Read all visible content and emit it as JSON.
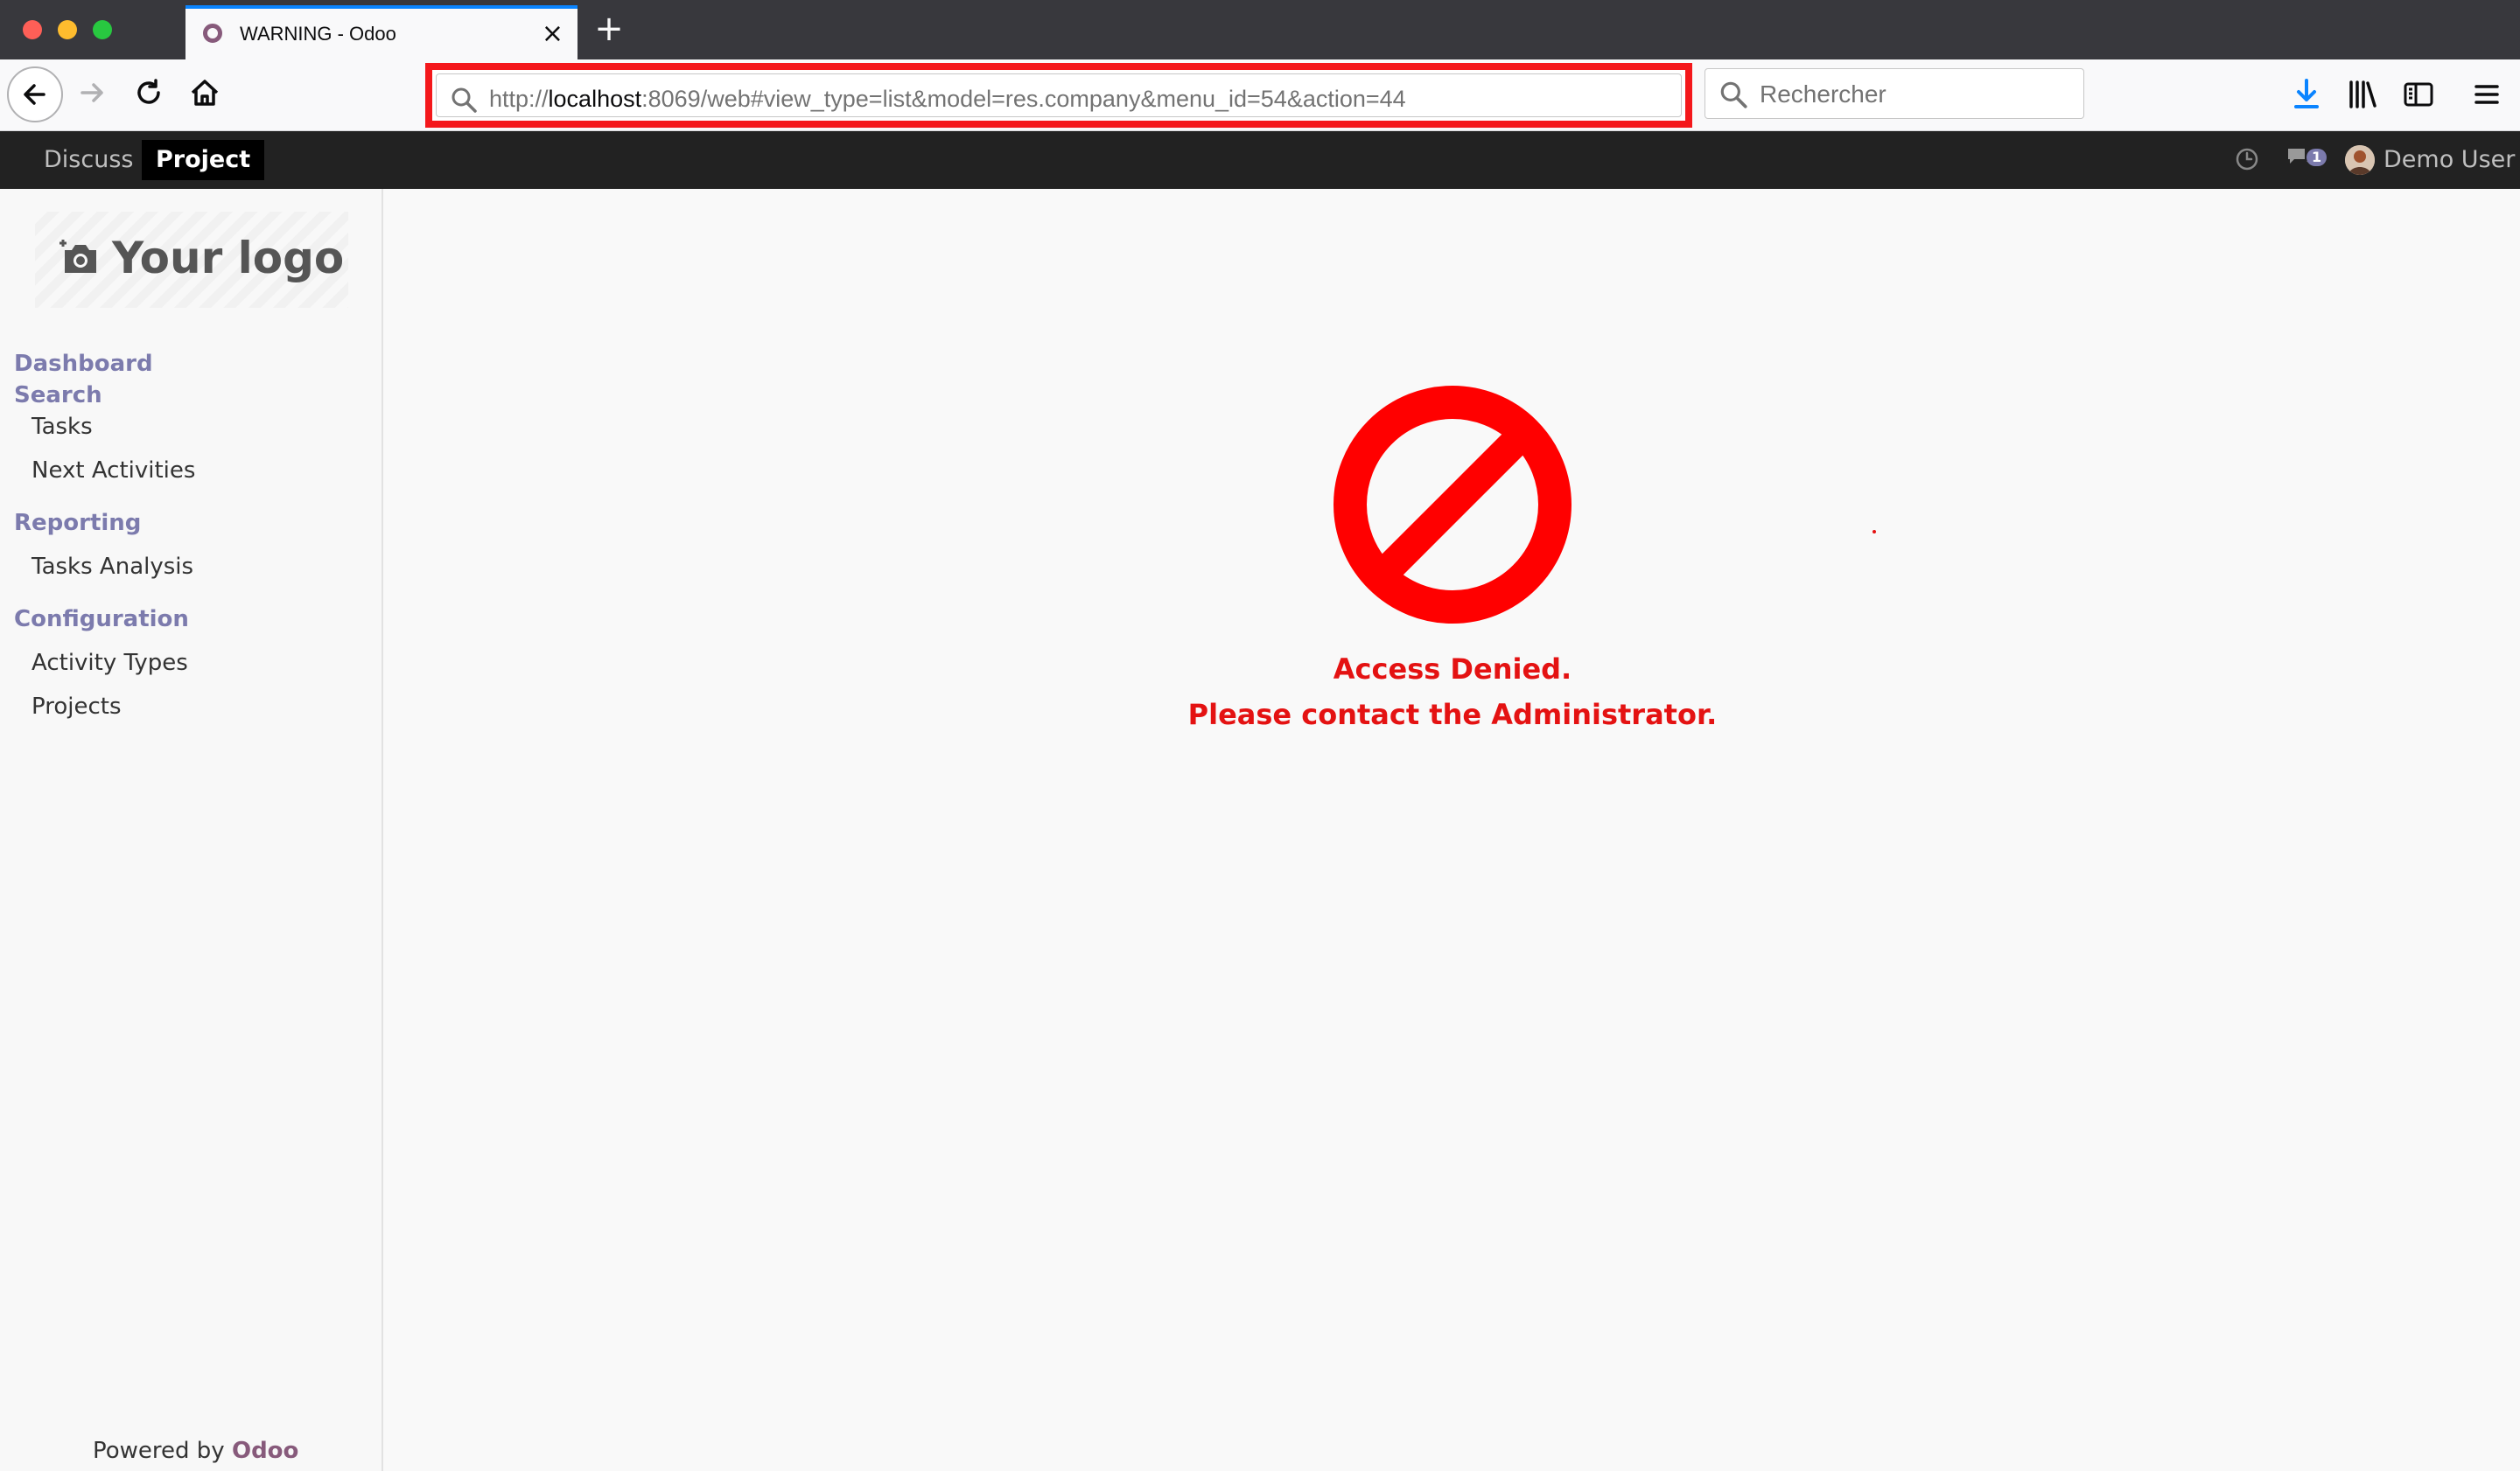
{
  "browser": {
    "tab_title": "WARNING - Odoo",
    "url_prefix": "http://",
    "url_host": "localhost",
    "url_rest": ":8069/web#view_type=list&model=res.company&menu_id=54&action=44",
    "search_placeholder": "Rechercher"
  },
  "topbar": {
    "apps": [
      "Discuss",
      "Project"
    ],
    "active_app": "Project",
    "chat_count": "1",
    "user_name": "Demo User"
  },
  "sidebar": {
    "logo_text": "Your logo",
    "sections": [
      {
        "title": "Dashboard",
        "items": []
      },
      {
        "title": "Search",
        "items": [
          "Tasks",
          "Next Activities"
        ]
      },
      {
        "title": "Reporting",
        "items": [
          "Tasks Analysis"
        ]
      },
      {
        "title": "Configuration",
        "items": [
          "Activity Types",
          "Projects"
        ]
      }
    ],
    "footer_prefix": "Powered by",
    "footer_brand": "Odoo"
  },
  "main": {
    "message_line1": "Access Denied.",
    "message_line2": "Please contact the Administrator."
  },
  "colors": {
    "odoo_purple": "#875a7b",
    "menu_heading": "#7c7bad",
    "error_red": "#e41212",
    "url_highlight": "#f4181b"
  }
}
